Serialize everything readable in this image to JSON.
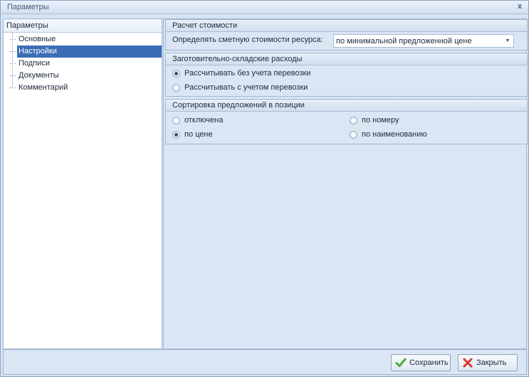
{
  "window": {
    "title": "Параметры",
    "close_glyph": "x"
  },
  "left": {
    "header": "Параметры",
    "items": [
      {
        "label": "Основные",
        "selected": false
      },
      {
        "label": "Настройки",
        "selected": true
      },
      {
        "label": "Подписи",
        "selected": false
      },
      {
        "label": "Документы",
        "selected": false
      },
      {
        "label": "Комментарий",
        "selected": false
      }
    ]
  },
  "cost": {
    "header": "Расчет стоимости",
    "label": "Определять сметную стоимости ресурса:",
    "combo_value": "по минимальной предложенной цене",
    "combo_arrow_icon": "chevron-down-icon"
  },
  "warehouse": {
    "header": "Заготовительно-складские расходы",
    "option1": "Рассчитывать без учета перевозки",
    "option2": "Рассчитывать с учетом перевозки",
    "selected": "option1"
  },
  "sorting": {
    "header": "Сортировка предложений в позиции",
    "option_off": "отключена",
    "option_price": "по цене",
    "option_number": "по номеру",
    "option_name": "по наименованию",
    "selected": "option_price"
  },
  "buttons": {
    "save": "Сохранить",
    "close": "Закрыть"
  },
  "colors": {
    "selection": "#3a6db5",
    "save_icon": "#4caf2a",
    "close_icon": "#d83c2c"
  }
}
